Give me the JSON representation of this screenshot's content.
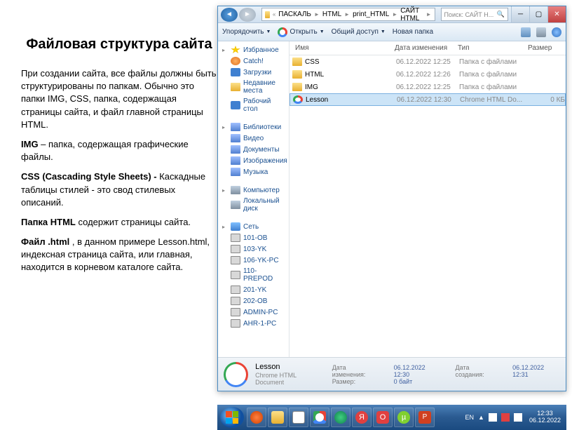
{
  "title": "Файловая структура сайта",
  "paragraphs": {
    "p1": "При создании сайта, все файлы должны быть структурированы по папкам. Обычно это папки IMG, CSS, папка, содержащая страницы сайта, и файл главной страницы HTML.",
    "p2_b": "IMG",
    "p2_r": " – папка, содержащая графические файлы.",
    "p3_b": "CSS (Cascading Style Sheets) -",
    "p3_r": " Каскадные таблицы стилей - это свод стилевых описаний.",
    "p4_b": "Папка HTML",
    "p4_r": " содержит страницы сайта.",
    "p5_b": "Файл .html",
    "p5_r": " , в данном примере Lesson.html, индексная страница сайта, или главная, находится в корневом каталоге сайта."
  },
  "breadcrumb": {
    "a": "ПАСКАЛЬ",
    "b": "HTML",
    "c": "print_HTML",
    "d": "САЙТ HTML"
  },
  "search": {
    "placeholder": "Поиск: САЙТ H..."
  },
  "toolbar": {
    "organize": "Упорядочить",
    "open": "Открыть",
    "share": "Общий доступ",
    "newfolder": "Новая папка"
  },
  "sidebar": {
    "fav": "Избранное",
    "favs": [
      "Catch!",
      "Загрузки",
      "Недавние места",
      "Рабочий стол"
    ],
    "lib": "Библиотеки",
    "libs": [
      "Видео",
      "Документы",
      "Изображения",
      "Музыка"
    ],
    "comp": "Компьютер",
    "comps": [
      "Локальный диск"
    ],
    "net": "Сеть",
    "nets": [
      "101-ОВ",
      "103-YK",
      "106-YK-PC",
      "110-PREPOD",
      "201-YK",
      "202-ОВ",
      "ADMIN-PC",
      "AHR-1-PC"
    ]
  },
  "cols": {
    "name": "Имя",
    "date": "Дата изменения",
    "type": "Тип",
    "size": "Размер"
  },
  "files": [
    {
      "name": "CSS",
      "date": "06.12.2022 12:25",
      "type": "Папка с файлами",
      "size": "",
      "kind": "folder"
    },
    {
      "name": "HTML",
      "date": "06.12.2022 12:26",
      "type": "Папка с файлами",
      "size": "",
      "kind": "folder"
    },
    {
      "name": "IMG",
      "date": "06.12.2022 12:25",
      "type": "Папка с файлами",
      "size": "",
      "kind": "folder"
    },
    {
      "name": "Lesson",
      "date": "06.12.2022 12:30",
      "type": "Chrome HTML Do...",
      "size": "0 КБ",
      "kind": "chrome",
      "selected": true
    }
  ],
  "details": {
    "name": "Lesson",
    "sub": "Chrome HTML Document",
    "date_lbl": "Дата изменения:",
    "date_val": "06.12.2022 12:30",
    "size_lbl": "Размер:",
    "size_val": "0 байт",
    "created_lbl": "Дата создания:",
    "created_val": "06.12.2022 12:31"
  },
  "tray": {
    "lang": "EN",
    "time": "12:33",
    "date": "06.12.2022"
  }
}
